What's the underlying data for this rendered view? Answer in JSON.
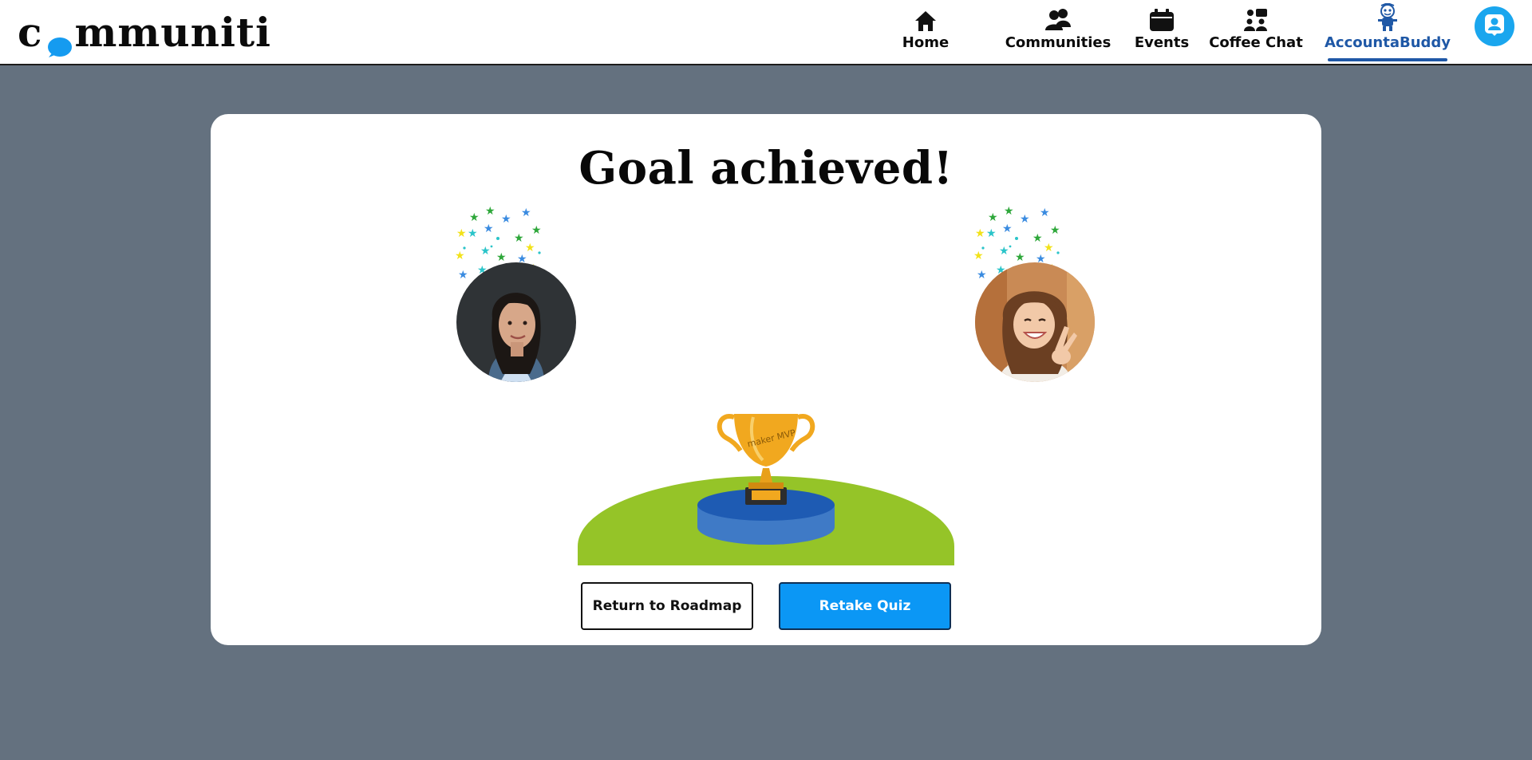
{
  "app": {
    "logo_text_pre": "c",
    "logo_text_post": "mmuniti"
  },
  "nav": {
    "items": [
      {
        "label": "Home",
        "icon": "home-icon"
      },
      {
        "label": "Communities",
        "icon": "communities-icon"
      },
      {
        "label": "Events",
        "icon": "calendar-icon"
      },
      {
        "label": "Coffee Chat",
        "icon": "coffee-chat-icon"
      },
      {
        "label": "AccountaBuddy",
        "icon": "accountabuddy-mascot-icon",
        "active": true
      }
    ],
    "profile_icon": "user-profile-icon"
  },
  "main": {
    "title": "Goal achieved!",
    "trophy_text": "maker MVP",
    "buttons": {
      "return_label": "Return to Roadmap",
      "retake_label": "Retake Quiz"
    }
  },
  "colors": {
    "background": "#64717f",
    "accent_blue": "#0b97f5",
    "active_nav": "#1f58a6",
    "grass": "#95c428",
    "podium": "#1e5bb3",
    "trophy_gold": "#f1a81f"
  }
}
